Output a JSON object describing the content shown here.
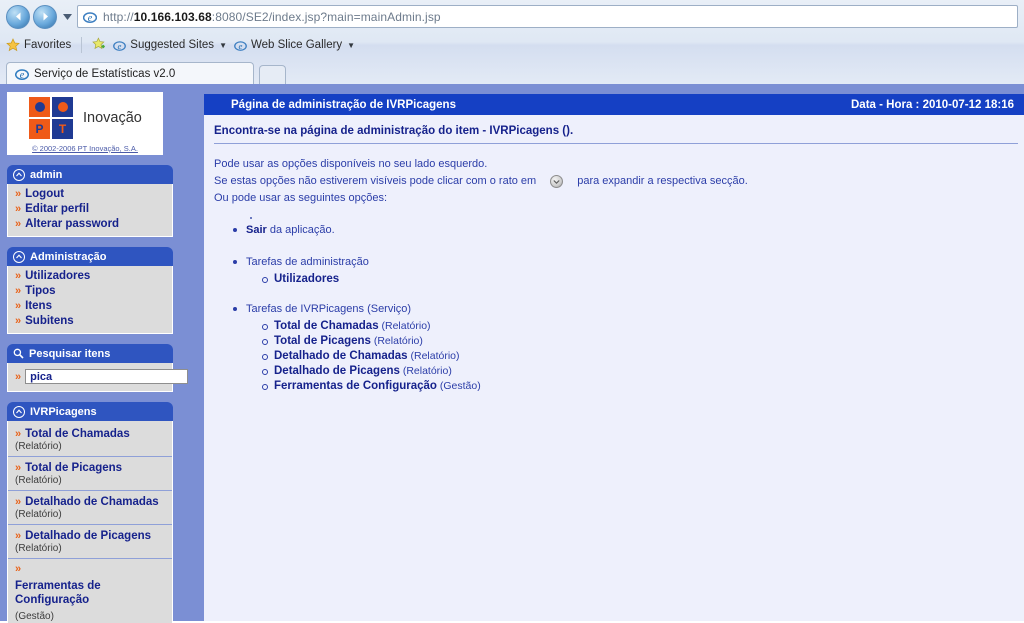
{
  "browser": {
    "url_prefix": "http://",
    "url_host": "10.166.103.68",
    "url_suffix": ":8080/SE2/index.jsp?main=mainAdmin.jsp",
    "back_icon": "back-arrow-icon",
    "forward_icon": "forward-arrow-icon",
    "recent_pages_icon": "chevron-down-icon",
    "favorites_bar": {
      "favorites_label": "Favorites",
      "suggested_sites_label": "Suggested Sites",
      "web_slice_label": "Web Slice Gallery"
    },
    "tab": {
      "title": "Serviço de Estatísticas v2.0",
      "new_tab_label": ""
    }
  },
  "sidebar": {
    "logo": {
      "word": "Inovação",
      "letter_p": "P",
      "letter_t": "T",
      "copyright": "© 2002-2006 PT Inovação, S.A."
    },
    "sections": [
      {
        "title": "admin",
        "icon": "expand-circle-icon",
        "items": [
          {
            "label": "Logout"
          },
          {
            "label": "Editar perfil"
          },
          {
            "label": "Alterar password"
          }
        ]
      },
      {
        "title": "Administração",
        "icon": "expand-circle-icon",
        "items": [
          {
            "label": "Utilizadores"
          },
          {
            "label": "Tipos"
          },
          {
            "label": "Itens"
          },
          {
            "label": "Subitens"
          }
        ]
      }
    ],
    "search": {
      "title": "Pesquisar itens",
      "icon": "search-icon",
      "value": "pica",
      "placeholder": ""
    },
    "service_section": {
      "title": "IVRPicagens",
      "icon": "expand-circle-icon",
      "reports": [
        {
          "name": "Total de Chamadas",
          "kind": "(Relatório)",
          "inline": false
        },
        {
          "name": "Total de Picagens",
          "kind": "(Relatório)",
          "inline": false
        },
        {
          "name": "Detalhado de Chamadas",
          "kind": "(Relatório)",
          "inline": false
        },
        {
          "name": "Detalhado de Picagens",
          "kind": "(Relatório)",
          "inline": false
        },
        {
          "name": "Ferramentas de Configuração",
          "kind": "(Gestão)",
          "inline": true
        }
      ]
    }
  },
  "main": {
    "header_title": "Página de administração de IVRPicagens",
    "header_datetime": "Data - Hora : 2010-07-12 18:16",
    "subheader": "Encontra-se na página de administração do item - IVRPicagens ().",
    "paragraph1": "Pode usar as opções disponíveis no seu lado esquerdo.",
    "paragraph2_before": "Se estas opções não estiverem visíveis pode clicar com o rato em",
    "paragraph2_after": "para expandir a respectiva secção.",
    "expand_icon": "expand-badge-icon",
    "paragraph3": "Ou pode usar as seguintes opções:",
    "bullet_exit_strong": "Sair",
    "bullet_exit_rest": " da aplicação.",
    "group_admin": {
      "title": "Tarefas de administração",
      "items": [
        {
          "name": "Utilizadores",
          "kind": ""
        }
      ]
    },
    "group_service": {
      "title": "Tarefas de IVRPicagens (Serviço)",
      "items": [
        {
          "name": "Total de Chamadas",
          "kind": " (Relatório)"
        },
        {
          "name": "Total de Picagens",
          "kind": " (Relatório)"
        },
        {
          "name": "Detalhado de Chamadas",
          "kind": " (Relatório)"
        },
        {
          "name": "Detalhado de Picagens",
          "kind": " (Relatório)"
        },
        {
          "name": "Ferramentas de Configuração",
          "kind": " (Gestão)"
        }
      ]
    }
  },
  "colors": {
    "sidebar_bg": "#7b8fd4",
    "header_blue": "#1540c4",
    "section_blue": "#2f55c0",
    "menu_bg": "#dcdcdc",
    "link_navy": "#16228c",
    "chevron_orange": "#e8641c",
    "content_bg": "#eef0fc",
    "logo_orange": "#ef5a18",
    "logo_blue": "#1f3a93"
  }
}
